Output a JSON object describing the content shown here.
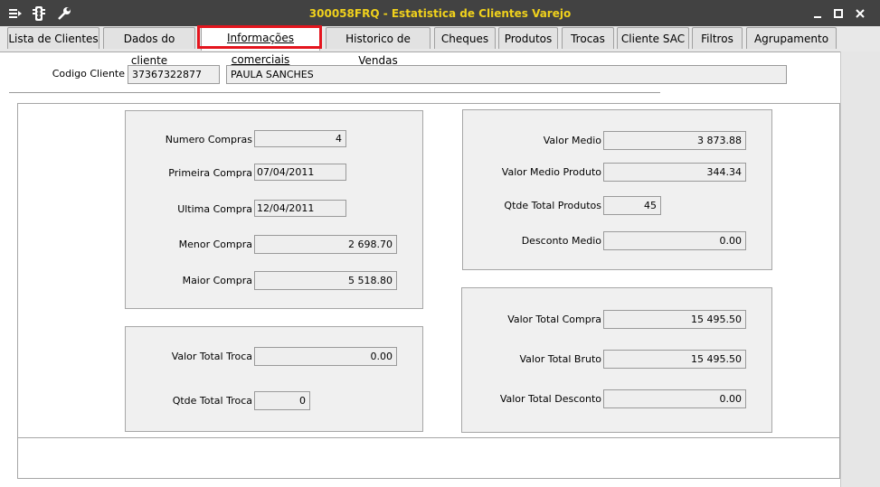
{
  "window": {
    "title": "300058FRQ - Estatistica de Clientes Varejo",
    "icons": [
      "menu-icon",
      "traffic-light-icon",
      "wrench-icon"
    ],
    "controls": [
      "minimize-icon",
      "maximize-icon",
      "close-icon"
    ],
    "title_color": "#f0d11c"
  },
  "tabs": [
    {
      "label": "Lista de Clientes"
    },
    {
      "label": "Dados do cliente"
    },
    {
      "label": "Informações comerciais",
      "active": true
    },
    {
      "label": "Historico de Vendas"
    },
    {
      "label": "Cheques"
    },
    {
      "label": "Produtos"
    },
    {
      "label": "Trocas"
    },
    {
      "label": "Cliente SAC"
    },
    {
      "label": "Filtros"
    },
    {
      "label": "Agrupamento"
    }
  ],
  "highlight_color": "#e4151e",
  "cliente": {
    "label": "Codigo Cliente",
    "code": "37367322877",
    "name": "PAULA SANCHES"
  },
  "compras": {
    "numero_compras": {
      "label": "Numero Compras",
      "value": "4"
    },
    "primeira_compra": {
      "label": "Primeira Compra",
      "value": "07/04/2011"
    },
    "ultima_compra": {
      "label": "Ultima Compra",
      "value": "12/04/2011"
    },
    "menor_compra": {
      "label": "Menor Compra",
      "value": "2 698.70"
    },
    "maior_compra": {
      "label": "Maior Compra",
      "value": "5 518.80"
    }
  },
  "trocas": {
    "valor_total_troca": {
      "label": "Valor Total Troca",
      "value": "0.00"
    },
    "qtde_total_troca": {
      "label": "Qtde Total Troca",
      "value": "0"
    }
  },
  "medias": {
    "valor_medio": {
      "label": "Valor Medio",
      "value": "3 873.88"
    },
    "valor_medio_produto": {
      "label": "Valor Medio Produto",
      "value": "344.34"
    },
    "qtde_total_produtos": {
      "label": "Qtde Total Produtos",
      "value": "45"
    },
    "desconto_medio": {
      "label": "Desconto Medio",
      "value": "0.00"
    }
  },
  "totais": {
    "valor_total_compra": {
      "label": "Valor Total Compra",
      "value": "15 495.50"
    },
    "valor_total_bruto": {
      "label": "Valor Total Bruto",
      "value": "15 495.50"
    },
    "valor_total_desconto": {
      "label": "Valor Total Desconto",
      "value": "0.00"
    }
  }
}
